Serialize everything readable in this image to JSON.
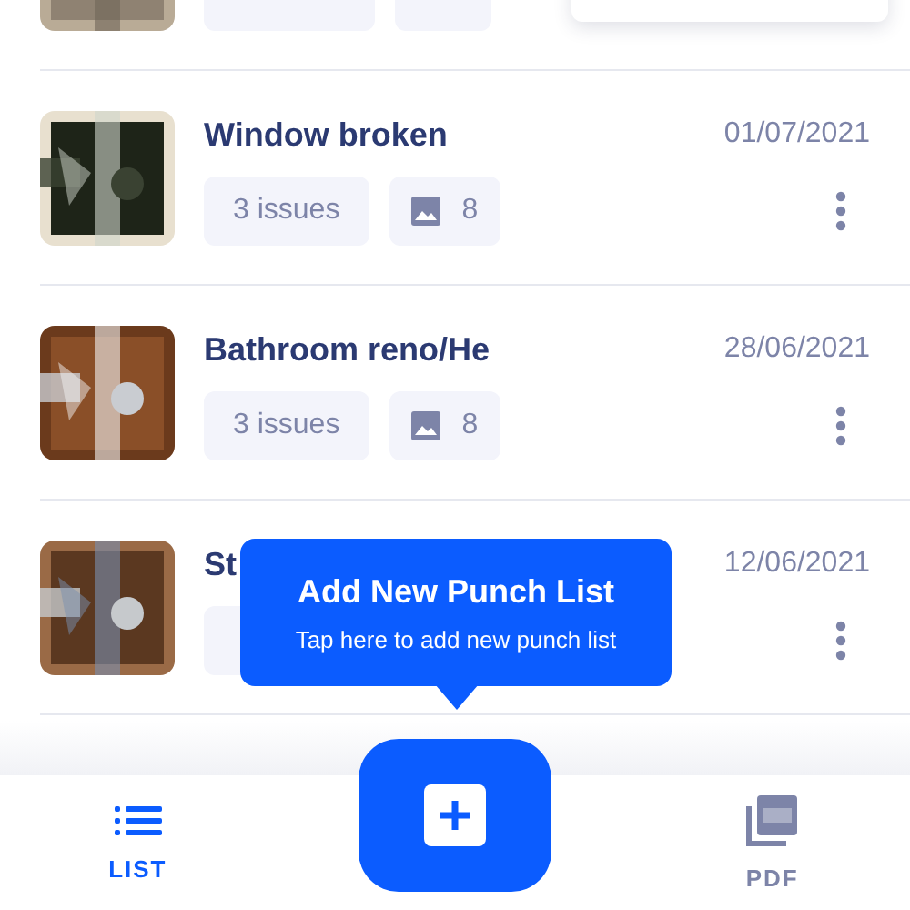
{
  "punch_lists": [
    {
      "kind": "partial"
    },
    {
      "kind": "full",
      "title": "Window broken",
      "date": "01/07/2021",
      "issues": "3 issues",
      "photos": "8"
    },
    {
      "kind": "full",
      "title": "Bathroom reno/He",
      "date": "28/06/2021",
      "issues": "3 issues",
      "photos": "8"
    },
    {
      "kind": "covered",
      "title": "St",
      "date": "12/06/2021"
    }
  ],
  "tooltip": {
    "title": "Add New Punch List",
    "text": "Tap here to add new punch list"
  },
  "nav": [
    {
      "label": "LIST",
      "kind": "list",
      "selected": true
    },
    {
      "kind": "add"
    },
    {
      "label": "PDF",
      "kind": "pdf",
      "selected": false
    }
  ]
}
